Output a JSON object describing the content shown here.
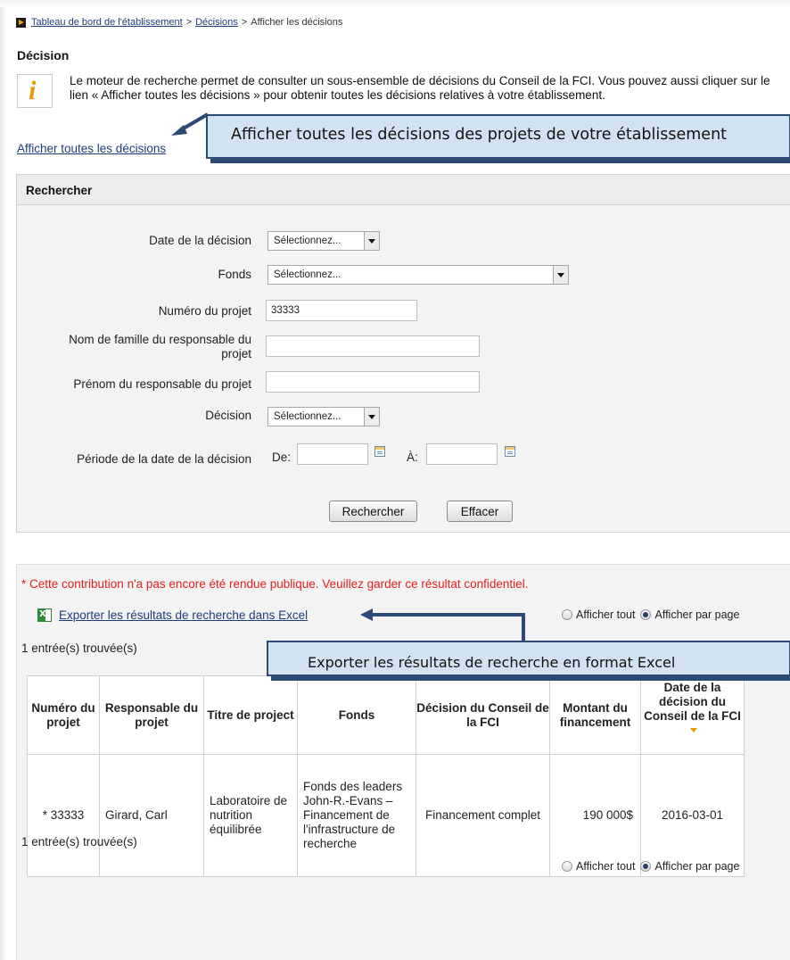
{
  "breadcrumb": {
    "items": [
      "Tableau de bord de l'établissement",
      "Décisions",
      "Afficher les décisions"
    ],
    "separator": ">"
  },
  "page_title": "Décision",
  "info": {
    "text": "Le moteur de recherche permet de consulter un sous-ensemble de décisions du Conseil de la FCI. Vous pouvez aussi cliquer sur le lien « Afficher toutes les décisions » pour obtenir toutes les décisions relatives à votre établissement.",
    "icon": "info-icon"
  },
  "show_all_link": "Afficher toutes les décisions",
  "callouts": {
    "show_all": "Afficher toutes les décisions des projets de votre établissement",
    "export": "Exporter les résultats de recherche en format Excel"
  },
  "search": {
    "header": "Rechercher",
    "labels": {
      "decision_date": "Date de la décision",
      "fund": "Fonds",
      "project_number": "Numéro du projet",
      "last_name": "Nom de famille du responsable du projet",
      "first_name": "Prénom du responsable du projet",
      "decision": "Décision",
      "period": "Période de la date de la décision",
      "from": "De:",
      "to": "À:"
    },
    "values": {
      "decision_date": "Sélectionnez...",
      "fund": "Sélectionnez...",
      "project_number": "33333",
      "last_name": "",
      "first_name": "",
      "decision": "Sélectionnez...",
      "from": "",
      "to": ""
    },
    "buttons": {
      "search": "Rechercher",
      "clear": "Effacer"
    }
  },
  "results": {
    "warning": "* Cette contribution n'a pas encore été rendue publique. Veuillez garder ce résultat confidentiel.",
    "export_link": "Exporter les résultats de recherche dans Excel",
    "display_all": "Afficher tout",
    "display_per_page": "Afficher par page",
    "display_selected": "per_page",
    "count_text": "1 entrée(s) trouvée(s)",
    "columns": [
      "Numéro du projet",
      "Responsable du projet",
      "Titre de project",
      "Fonds",
      "Décision du Conseil de la FCI",
      "Montant du financement",
      "Date de la décision du Conseil de la FCI"
    ],
    "rows": [
      {
        "number": "* 33333",
        "responsible": "Girard, Carl",
        "title": "Laboratoire de nutrition équilibrée",
        "fund": "Fonds des leaders John-R.-Evans – Financement de l'infrastructure de recherche",
        "decision": "Financement complet",
        "amount": "190 000$",
        "date": "2016-03-01"
      }
    ]
  },
  "colors": {
    "link": "#1d3d7a",
    "warning": "#e02020",
    "callout_fill": "#d3e2f3",
    "callout_border": "#2c4a73",
    "accent": "#e49b00"
  }
}
